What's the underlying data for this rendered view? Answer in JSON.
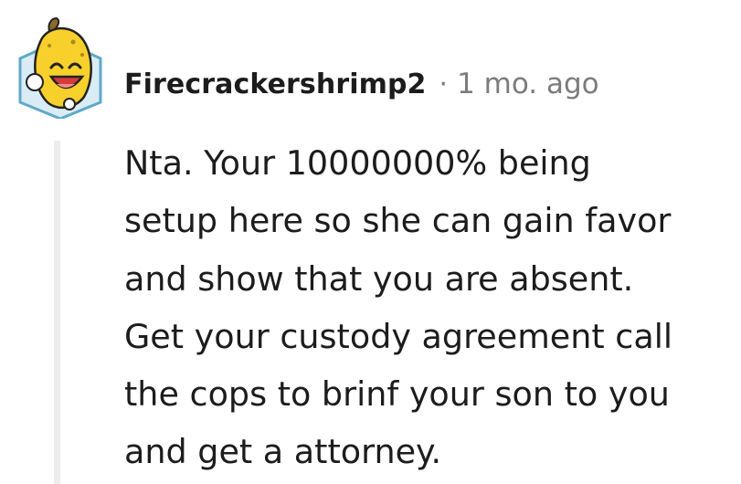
{
  "comment": {
    "avatar_icon": "banana-snoo-avatar-icon",
    "username": "Firecrackershrimp2",
    "separator": "·",
    "timestamp": "1 mo. ago",
    "body_lines": [
      "Nta. Your 10000000% being",
      "setup here so she can gain favor",
      "and show that you are absent.",
      "Get your custody agreement call",
      "the cops to brinf your son to you",
      "and get a attorney."
    ]
  },
  "colors": {
    "text": "#1c1c1c",
    "meta": "#7c7c7c",
    "thread_line": "#ededed",
    "avatar_frame": "#5fa8c8",
    "banana": "#f7d02c"
  }
}
